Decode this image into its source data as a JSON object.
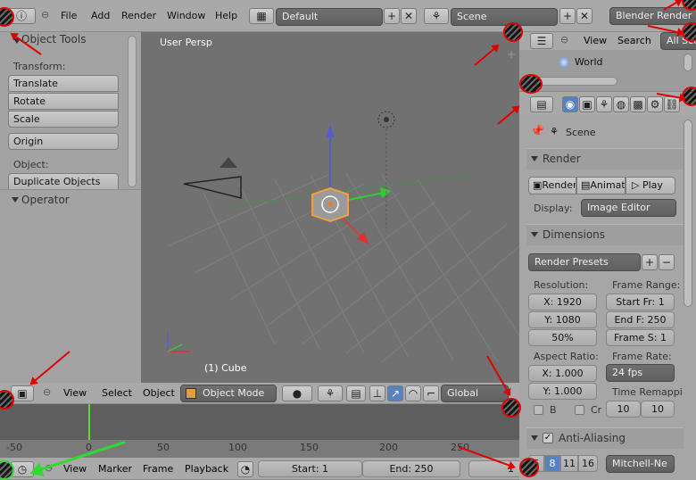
{
  "top_menu": {
    "items": [
      "File",
      "Add",
      "Render",
      "Window",
      "Help"
    ],
    "screen_layout": "Default",
    "scene": "Scene",
    "engine": "Blender Render"
  },
  "tool_shelf": {
    "header": "Object Tools",
    "transform_label": "Transform:",
    "translate": "Translate",
    "rotate": "Rotate",
    "scale": "Scale",
    "origin": "Origin",
    "object_label": "Object:",
    "duplicate": "Duplicate Objects",
    "operator": "Operator"
  },
  "viewport": {
    "view_name": "User Persp",
    "object_label": "(1) Cube",
    "header": {
      "view": "View",
      "select": "Select",
      "object": "Object",
      "mode": "Object Mode",
      "orientation": "Global"
    }
  },
  "outliner": {
    "view": "View",
    "search": "Search",
    "filter": "All Sce",
    "world": "World"
  },
  "properties": {
    "scene_path": "Scene",
    "render": {
      "title": "Render",
      "render_btn": "Render",
      "anim_btn": "Animat",
      "play_btn": "Play",
      "display_label": "Display:",
      "display_value": "Image Editor"
    },
    "dimensions": {
      "title": "Dimensions",
      "presets": "Render Presets",
      "resolution_label": "Resolution:",
      "res_x": "X: 1920",
      "res_y": "Y: 1080",
      "res_pct": "50%",
      "frame_range_label": "Frame Range:",
      "start": "Start Fr: 1",
      "end": "End F: 250",
      "step": "Frame S: 1",
      "aspect_label": "Aspect Ratio:",
      "aspect_x": "X: 1.000",
      "aspect_y": "Y: 1.000",
      "frame_rate_label": "Frame Rate:",
      "fps": "24 fps",
      "remap_label": "Time Remappi",
      "remap_old": "10",
      "remap_new": "10",
      "border": "B",
      "crop": "Cr"
    },
    "anti_aliasing": {
      "title": "Anti-Aliasing",
      "samples": [
        "5",
        "8",
        "11",
        "16"
      ],
      "filter": "Mitchell-Ne"
    }
  },
  "timeline": {
    "ticks": [
      "-50",
      "0",
      "50",
      "100",
      "150",
      "200",
      "250"
    ],
    "view": "View",
    "marker": "Marker",
    "frame": "Frame",
    "playback": "Playback",
    "start": "Start: 1",
    "end": "End: 250",
    "current": "1"
  },
  "colors": {
    "annotation_red": "#e00000",
    "annotation_green": "#2ddc2d"
  }
}
